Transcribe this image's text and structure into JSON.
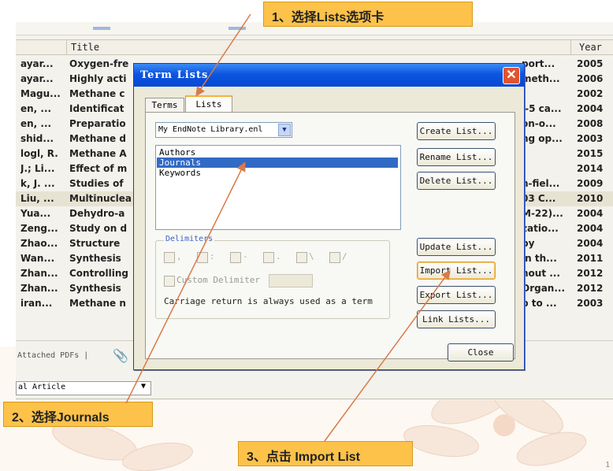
{
  "callouts": {
    "step1": "1、选择Lists选项卡",
    "step2": "2、选择Journals",
    "step3": "3、点击 Import List"
  },
  "library": {
    "columns": {
      "title": "Title",
      "year": "Year"
    },
    "rows": [
      {
        "author": "ayar...",
        "title": "Oxygen-fre",
        "right": "port...",
        "year": "2005"
      },
      {
        "author": "ayar...",
        "title": "Highly acti",
        "right": "meth...",
        "year": "2006"
      },
      {
        "author": "Magu...",
        "title": "Methane c",
        "right": "",
        "year": "2002"
      },
      {
        "author": "en, ...",
        "title": "Identificat",
        "right": "l-5 ca...",
        "year": "2004"
      },
      {
        "author": "en, ...",
        "title": "Preparatio",
        "right": "on-o...",
        "year": "2008"
      },
      {
        "author": "shid...",
        "title": "Methane d",
        "right": "ng op...",
        "year": "2003"
      },
      {
        "author": "logl, R.",
        "title": "Methane A",
        "right": "",
        "year": "2015"
      },
      {
        "author": "J.; Li...",
        "title": "Effect of m",
        "right": "",
        "year": "2014"
      },
      {
        "author": "k, J. ...",
        "title": "Studies of",
        "right": "h-fiel...",
        "year": "2009"
      },
      {
        "author": "Liu, ...",
        "title": "Multinuclea",
        "right": "03 C...",
        "year": "2010"
      },
      {
        "author": "Yua...",
        "title": "Dehydro-a",
        "right": "M-22)...",
        "year": "2004"
      },
      {
        "author": "Zeng...",
        "title": "Study on d",
        "right": "zatio...",
        "year": "2004"
      },
      {
        "author": "Zhao...",
        "title": "Structure",
        "right": "py",
        "year": "2004"
      },
      {
        "author": "Wan...",
        "title": "Synthesis",
        "right": "in th...",
        "year": "2011"
      },
      {
        "author": "Zhan...",
        "title": "Controlling",
        "right": "hout ...",
        "year": "2012"
      },
      {
        "author": "Zhan...",
        "title": "Synthesis",
        "right": "Organ...",
        "year": "2012"
      },
      {
        "author": "iran...",
        "title": "Methane n",
        "right": "p to ...",
        "year": "2003"
      }
    ],
    "attached_pdfs": "Attached PDFs",
    "ref_type": "al Article"
  },
  "dialog": {
    "title": "Term Lists",
    "tabs": [
      "Terms",
      "Lists"
    ],
    "active_tab": "Lists",
    "library_select": "My EndNote Library.enl",
    "lists": [
      "Authors",
      "Journals",
      "Keywords"
    ],
    "selected_list": "Journals",
    "buttons": {
      "create": "Create List...",
      "rename": "Rename List...",
      "delete": "Delete List...",
      "update": "Update List...",
      "import": "Import List...",
      "export": "Export List...",
      "link": "Link Lists...",
      "close": "Close"
    },
    "delimiters": {
      "legend": "Delimiters",
      "options": [
        ",",
        ":",
        "-",
        ".",
        "\\",
        "/"
      ],
      "custom_label": "Custom Delimiter",
      "note": "Carriage return is always used as a term"
    }
  },
  "page_number": "1",
  "colors": {
    "callout": "#fcc24a",
    "arrow": "#d97a4a",
    "selection": "#316ac5",
    "titlebar": "#0c55e0"
  }
}
